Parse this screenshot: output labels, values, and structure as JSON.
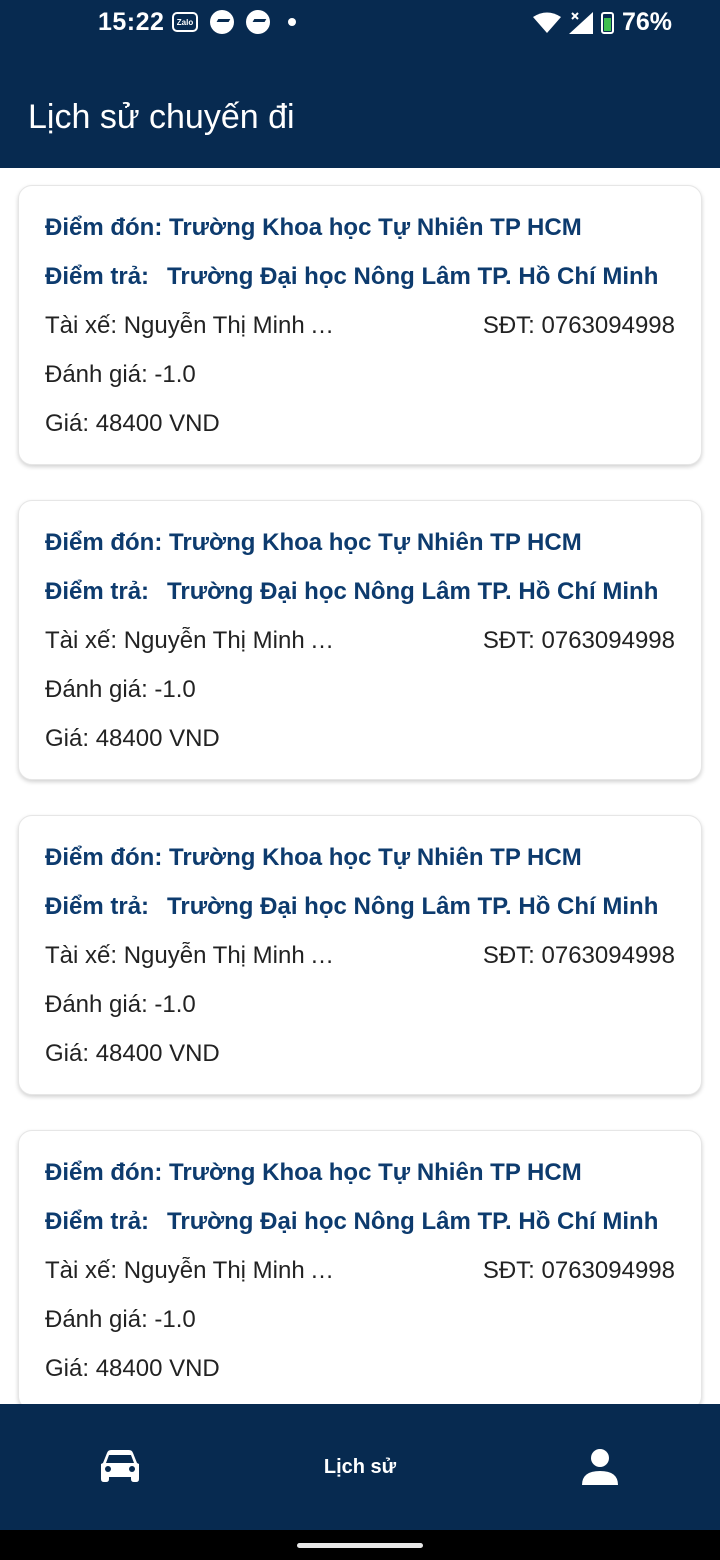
{
  "status_bar": {
    "time": "15:22",
    "zalo_label": "Zalo",
    "battery": "76%",
    "icons": [
      "zalo-icon",
      "messenger-icon",
      "messenger-icon",
      "dot-icon",
      "wifi-icon",
      "signal-icon",
      "battery-icon"
    ]
  },
  "app_bar": {
    "title": "Lịch sử chuyến đi"
  },
  "trips": [
    {
      "pickup_label": "Điểm đón:",
      "pickup": "Trường Khoa học Tự Nhiên TP HCM",
      "dropoff_label": "Điểm trả:",
      "dropoff": "Trường Đại học Nông Lâm TP. Hồ Chí Minh",
      "driver_label": "Tài xế:",
      "driver": "Nguyễn Thị Minh Anh",
      "phone_label": "SĐT:",
      "phone": "0763094998",
      "rating_label": "Đánh giá:",
      "rating": "-1.0",
      "price_label": "Giá:",
      "price": "48400 VND"
    },
    {
      "pickup_label": "Điểm đón:",
      "pickup": "Trường Khoa học Tự Nhiên TP HCM",
      "dropoff_label": "Điểm trả:",
      "dropoff": "Trường Đại học Nông Lâm TP. Hồ Chí Minh",
      "driver_label": "Tài xế:",
      "driver": "Nguyễn Thị Minh Anh",
      "phone_label": "SĐT:",
      "phone": "0763094998",
      "rating_label": "Đánh giá:",
      "rating": "-1.0",
      "price_label": "Giá:",
      "price": "48400 VND"
    },
    {
      "pickup_label": "Điểm đón:",
      "pickup": "Trường Khoa học Tự Nhiên TP HCM",
      "dropoff_label": "Điểm trả:",
      "dropoff": "Trường Đại học Nông Lâm TP. Hồ Chí Minh",
      "driver_label": "Tài xế:",
      "driver": "Nguyễn Thị Minh Anh",
      "phone_label": "SĐT:",
      "phone": "0763094998",
      "rating_label": "Đánh giá:",
      "rating": "-1.0",
      "price_label": "Giá:",
      "price": "48400 VND"
    },
    {
      "pickup_label": "Điểm đón:",
      "pickup": "Trường Khoa học Tự Nhiên TP HCM",
      "dropoff_label": "Điểm trả:",
      "dropoff": "Trường Đại học Nông Lâm TP. Hồ Chí Minh",
      "driver_label": "Tài xế:",
      "driver": "Nguyễn Thị Minh Anh",
      "phone_label": "SĐT:",
      "phone": "0763094998",
      "rating_label": "Đánh giá:",
      "rating": "-1.0",
      "price_label": "Giá:",
      "price": "48400 VND"
    }
  ],
  "bottom_nav": {
    "items": [
      {
        "icon": "car-icon",
        "label": ""
      },
      {
        "icon": "",
        "label": "Lịch sử"
      },
      {
        "icon": "person-icon",
        "label": ""
      }
    ]
  },
  "colors": {
    "primary": "#072a50",
    "label_text": "#0d3b6e",
    "body_text": "#222222"
  }
}
